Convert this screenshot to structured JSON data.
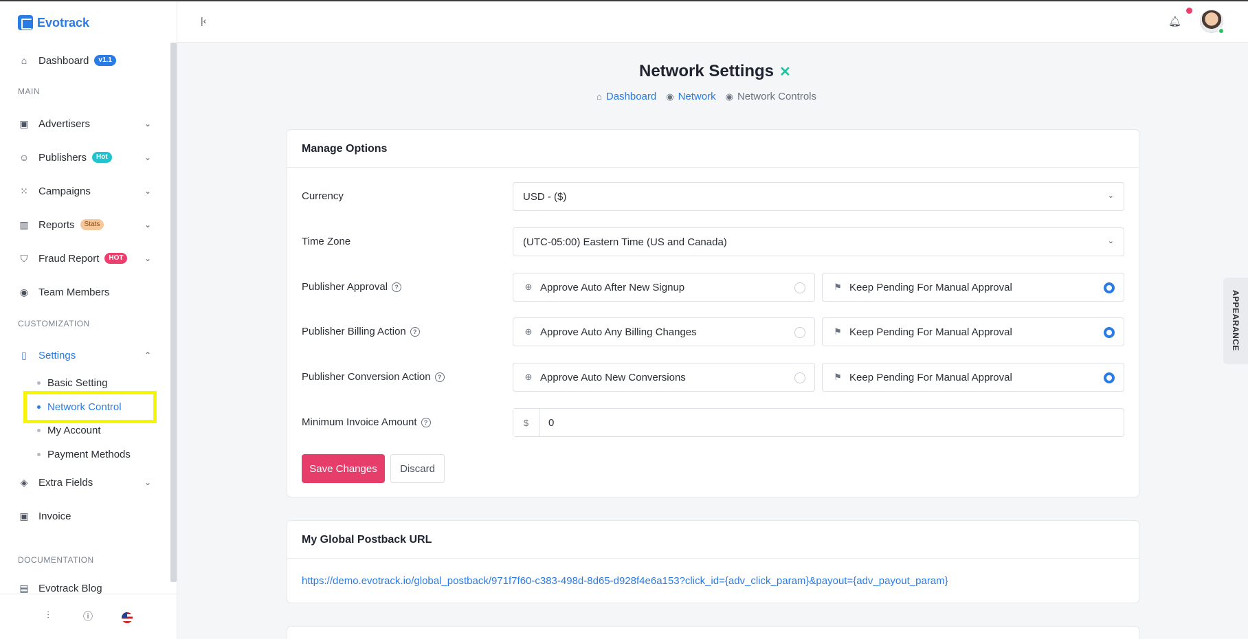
{
  "app": {
    "name": "Evotrack"
  },
  "sidebar": {
    "dashboard": {
      "label": "Dashboard",
      "badge": "v1.1"
    },
    "section_main": "MAIN",
    "items": [
      {
        "label": "Advertisers",
        "icon": "contact-icon"
      },
      {
        "label": "Publishers",
        "badge": "Hot",
        "icon": "smile-icon"
      },
      {
        "label": "Campaigns",
        "icon": "grid-icon"
      },
      {
        "label": "Reports",
        "badge": "Stats",
        "icon": "bar-chart-icon"
      },
      {
        "label": "Fraud Report",
        "badge": "HOT",
        "icon": "shield-icon"
      },
      {
        "label": "Team Members",
        "icon": "eye-icon"
      }
    ],
    "section_customization": "CUSTOMIZATION",
    "settings": {
      "label": "Settings",
      "children": [
        "Basic Setting",
        "Network Control",
        "My Account",
        "Payment Methods"
      ],
      "active": "Network Control"
    },
    "extra_fields": "Extra Fields",
    "invoice": "Invoice",
    "section_documentation": "DOCUMENTATION",
    "blog": "Evotrack Blog"
  },
  "page": {
    "title": "Network Settings",
    "breadcrumb": [
      "Dashboard",
      "Network",
      "Network Controls"
    ]
  },
  "manage_options": {
    "header": "Manage Options",
    "currency": {
      "label": "Currency",
      "value": "USD - ($)"
    },
    "timezone": {
      "label": "Time Zone",
      "value": "(UTC-05:00) Eastern Time (US and Canada)"
    },
    "publisher_approval": {
      "label": "Publisher Approval",
      "option_a": "Approve Auto After New Signup",
      "option_b": "Keep Pending For Manual Approval",
      "selected": "option_b"
    },
    "billing_action": {
      "label": "Publisher Billing Action",
      "option_a": "Approve Auto Any Billing Changes",
      "option_b": "Keep Pending For Manual Approval",
      "selected": "option_b"
    },
    "conversion_action": {
      "label": "Publisher Conversion Action",
      "option_a": "Approve Auto New Conversions",
      "option_b": "Keep Pending For Manual Approval",
      "selected": "option_b"
    },
    "min_invoice": {
      "label": "Minimum Invoice Amount",
      "prefix": "$",
      "value": "0"
    },
    "save_label": "Save Changes",
    "discard_label": "Discard"
  },
  "postback": {
    "header": "My Global Postback URL",
    "url": "https://demo.evotrack.io/global_postback/971f7f60-c383-498d-8d65-d928f4e6a153?click_id={adv_click_param}&payout={adv_payout_param}"
  },
  "appearance_tab": "APPEARANCE",
  "colors": {
    "primary": "#2a7be4",
    "danger": "#e63d6b",
    "highlight": "#f5f50a"
  }
}
